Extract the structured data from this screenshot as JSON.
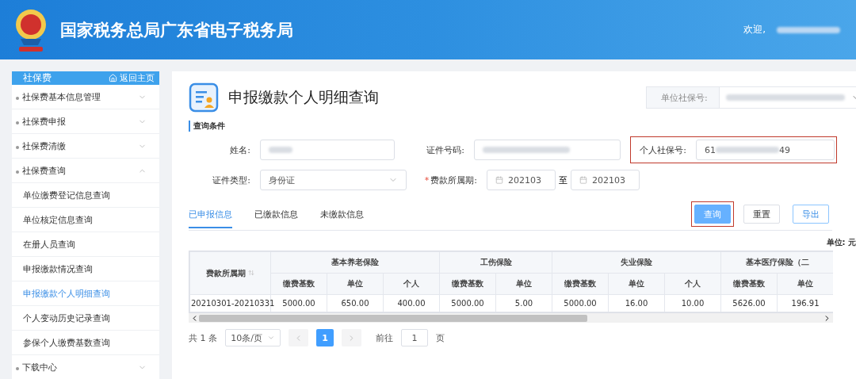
{
  "header": {
    "title": "国家税务总局广东省电子税务局",
    "greeting": "欢迎,"
  },
  "sidebar": {
    "title": "社保费",
    "home_link": "返回主页",
    "items": [
      {
        "label": "社保费基本信息管理",
        "expanded": false
      },
      {
        "label": "社保费申报",
        "expanded": false
      },
      {
        "label": "社保费清缴",
        "expanded": false
      },
      {
        "label": "社保费查询",
        "expanded": true,
        "children": [
          {
            "label": "单位缴费登记信息查询",
            "selected": false
          },
          {
            "label": "单位核定信息查询",
            "selected": false
          },
          {
            "label": "在册人员查询",
            "selected": false
          },
          {
            "label": "申报缴款情况查询",
            "selected": false
          },
          {
            "label": "申报缴款个人明细查询",
            "selected": true
          },
          {
            "label": "个人变动历史记录查询",
            "selected": false
          },
          {
            "label": "参保个人缴费基数查询",
            "selected": false
          }
        ]
      },
      {
        "label": "下载中心",
        "expanded": false
      }
    ]
  },
  "page": {
    "title": "申报缴款个人明细查询",
    "unit_field": {
      "label": "单位社保号:"
    }
  },
  "conditions": {
    "title": "查询条件",
    "rows": [
      [
        {
          "kind": "text",
          "label": "姓名:"
        },
        {
          "kind": "text",
          "label": "证件号码:"
        },
        {
          "kind": "partial",
          "label": "个人社保号:",
          "prefix": "61",
          "suffix": "49",
          "highlighted": true
        }
      ],
      [
        {
          "kind": "select",
          "label": "证件类型:",
          "value": "身份证"
        },
        {
          "kind": "range",
          "label": "费款所属期:",
          "required_mark": "*",
          "from": "202103",
          "sep": "至",
          "to": "202103"
        }
      ]
    ]
  },
  "tabs": [
    {
      "label": "已申报信息",
      "selected": true
    },
    {
      "label": "已缴款信息",
      "selected": false
    },
    {
      "label": "未缴款信息",
      "selected": false
    }
  ],
  "buttons": [
    {
      "label": "查询",
      "kind": "primary",
      "highlighted": true
    },
    {
      "label": "重置",
      "kind": "default",
      "highlighted": false
    },
    {
      "label": "导出",
      "kind": "outline",
      "highlighted": false
    }
  ],
  "unit_note": "单位: 元",
  "table": {
    "first_column": "费款所属期",
    "groups": [
      {
        "label": "基本养老保险",
        "columns": [
          "缴费基数",
          "单位",
          "个人"
        ]
      },
      {
        "label": "工伤保险",
        "columns": [
          "缴费基数",
          "单位"
        ]
      },
      {
        "label": "失业保险",
        "columns": [
          "缴费基数",
          "单位",
          "个人"
        ]
      },
      {
        "label": "基本医疗保险（二",
        "columns": [
          "缴费基数",
          "单位"
        ]
      }
    ],
    "rows": [
      [
        "20210301-20210331",
        "5000.00",
        "650.00",
        "400.00",
        "5000.00",
        "5.00",
        "5000.00",
        "16.00",
        "10.00",
        "5626.00",
        "196.91"
      ]
    ]
  },
  "pagination": {
    "total": "共 1 条",
    "page_size": "10条/页",
    "pages": [
      {
        "label": "1",
        "selected": true
      }
    ],
    "goto_label": "前往",
    "goto_value": "1",
    "page_suffix": "页"
  }
}
